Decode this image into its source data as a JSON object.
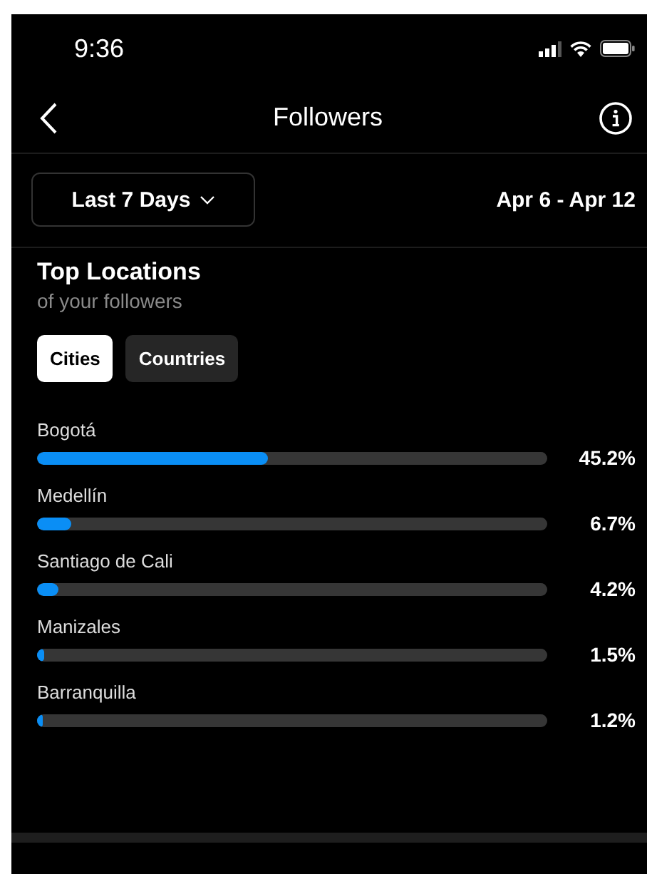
{
  "status_bar": {
    "time": "9:36"
  },
  "header": {
    "title": "Followers"
  },
  "filter": {
    "range": "Last 7 Days",
    "dates": "Apr 6 - Apr 12"
  },
  "section": {
    "title": "Top Locations",
    "subtitle": "of your followers"
  },
  "tabs": [
    {
      "label": "Cities",
      "selected": true
    },
    {
      "label": "Countries",
      "selected": false
    }
  ],
  "locations": [
    {
      "name": "Bogotá",
      "level": 0.452,
      "reading": "45.2%"
    },
    {
      "name": "Medellín",
      "level": 0.067,
      "reading": "6.7%"
    },
    {
      "name": "Santiago de Cali",
      "level": 0.042,
      "reading": "4.2%"
    },
    {
      "name": "Manizales",
      "level": 0.015,
      "reading": "1.5%"
    },
    {
      "name": "Barranquilla",
      "level": 0.012,
      "reading": "1.2%"
    }
  ]
}
